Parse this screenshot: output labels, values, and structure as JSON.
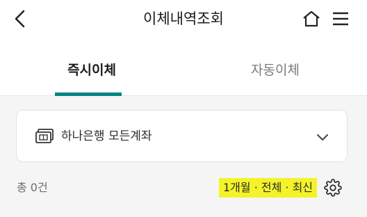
{
  "header": {
    "title": "이체내역조회",
    "back_icon": "chevron-left-icon",
    "home_icon": "home-icon",
    "menu_icon": "hamburger-menu-icon"
  },
  "tabs": [
    {
      "label": "즉시이체",
      "selected": true
    },
    {
      "label": "자동이체",
      "selected": false
    }
  ],
  "account_selector": {
    "icon": "bank-passbook-icon",
    "label": "하나은행 모든계좌",
    "dropdown_icon": "chevron-down-icon"
  },
  "summary": {
    "total": "총 0건",
    "filter": "1개월 · 전체 · 최신",
    "settings_icon": "gear-icon"
  },
  "colors": {
    "accent": "#008485",
    "highlight": "#f4f32a",
    "background": "#f5f5f5"
  }
}
